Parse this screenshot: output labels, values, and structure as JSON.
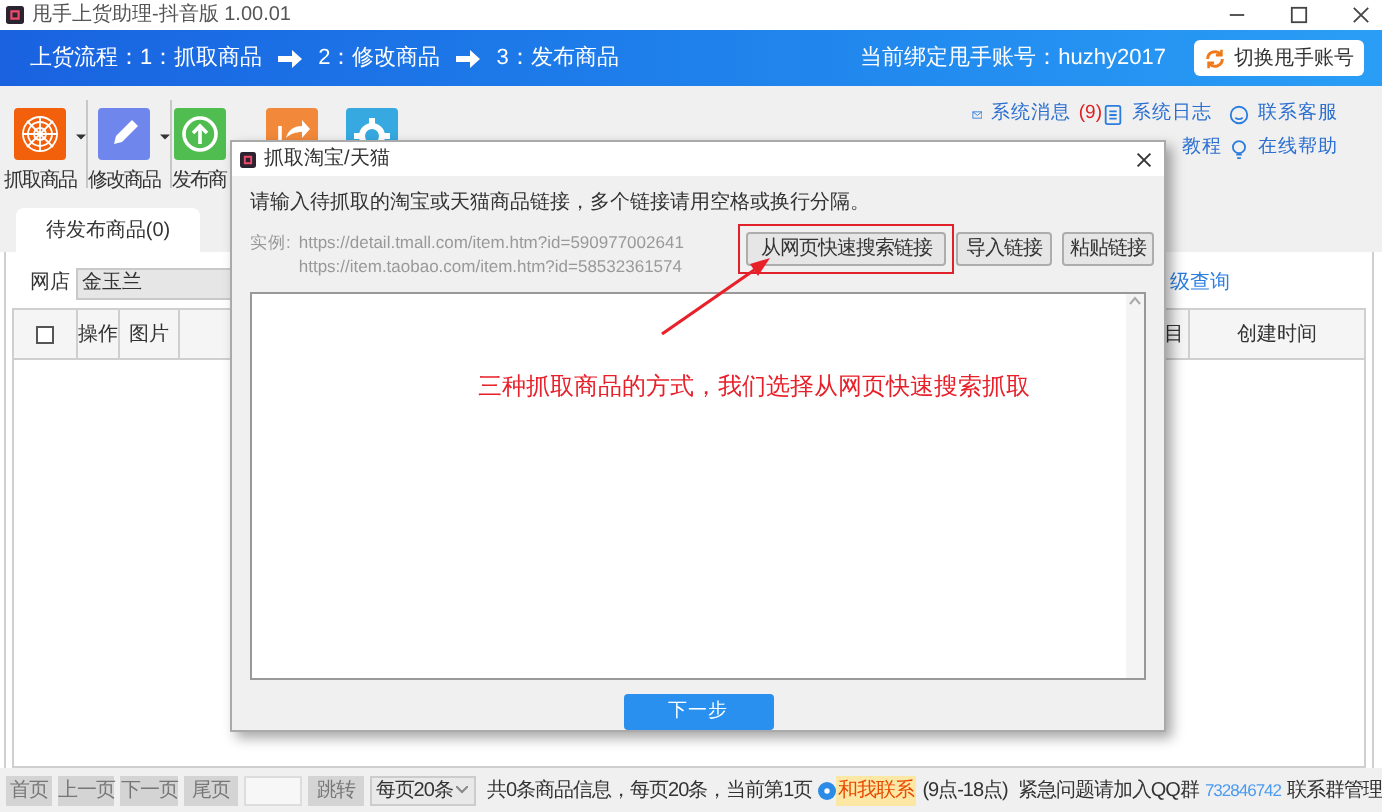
{
  "window": {
    "title": "甩手上货助理-抖音版 1.00.01"
  },
  "banner": {
    "steps": [
      "上货流程：1：抓取商品",
      "2：修改商品",
      "3：发布商品"
    ],
    "account": "当前绑定甩手账号：huzhy2017",
    "switch_button": "切换甩手账号"
  },
  "toolbar": {
    "tools": [
      {
        "kind": "spider",
        "label": "抓取商品",
        "dropdown": true
      },
      {
        "kind": "edit",
        "label": "修改商品",
        "dropdown": true
      },
      {
        "kind": "upload",
        "label": "发布商"
      },
      {
        "kind": "share"
      },
      {
        "kind": "gear"
      }
    ],
    "links": [
      {
        "kind": "mail",
        "label": "系统消息",
        "count": "(9)"
      },
      {
        "kind": "log",
        "label": "系统日志"
      },
      {
        "kind": "service",
        "label": "联系客服"
      },
      {
        "kind": "hidden"
      },
      {
        "kind": "cut",
        "label": "教程"
      },
      {
        "kind": "bulb",
        "label": "在线帮助"
      }
    ]
  },
  "tabs": [
    {
      "label": "待发布商品(0)",
      "selected": true
    }
  ],
  "filter": {
    "label": "网店",
    "shop": "金玉兰",
    "link": "级查询"
  },
  "table": {
    "select_all": {
      "checked": false
    },
    "columns_left": [
      "操作",
      "图片"
    ],
    "columns_right": [
      "目",
      "创建时间"
    ]
  },
  "pager": {
    "buttons": [
      "首页",
      "上一页",
      "下一页",
      "尾页"
    ],
    "jump_button": "跳转",
    "page_size": "每页20条",
    "summary": "共0条商品信息，每页20条，当前第1页",
    "contact": "和我联系",
    "hours": "(9点-18点)",
    "qq_text": "紧急问题请加入QQ群",
    "qq_number": "732846742",
    "manage": "联系群管理"
  },
  "dialog": {
    "title": "抓取淘宝/天猫",
    "instruction": "请输入待抓取的淘宝或天猫商品链接，多个链接请用空格或换行分隔。",
    "example_label": "实例:",
    "examples": [
      "https://detail.tmall.com/item.htm?id=590977002641",
      "https://item.taobao.com/item.htm?id=58532361574"
    ],
    "buttons": [
      {
        "label": "从网页快速搜索链接",
        "highlighted": true
      },
      {
        "label": "导入链接",
        "highlighted": false
      },
      {
        "label": "粘贴链接",
        "highlighted": false
      }
    ],
    "annotation": "三种抓取商品的方式，我们选择从网页快速搜索抓取",
    "next_button": "下一步"
  }
}
